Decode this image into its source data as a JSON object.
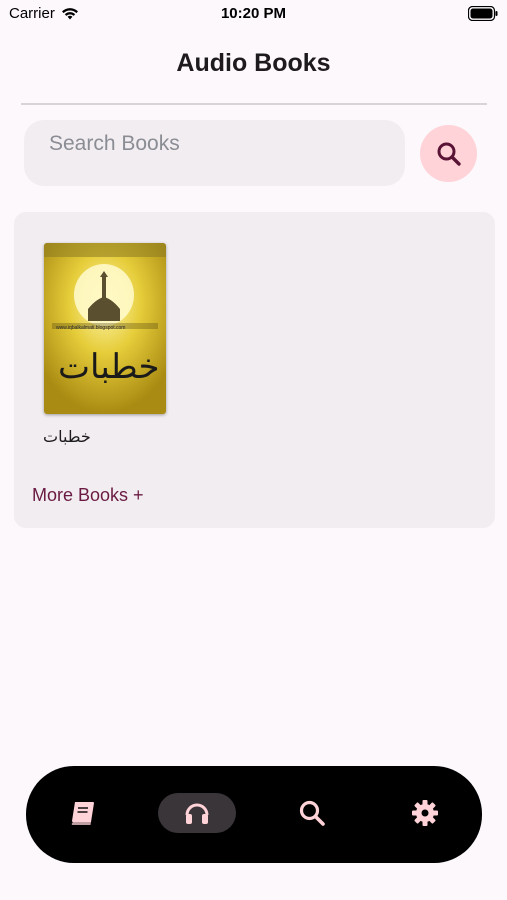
{
  "status_bar": {
    "carrier": "Carrier",
    "time": "10:20 PM"
  },
  "header": {
    "title": "Audio Books"
  },
  "search": {
    "placeholder": "Search Books",
    "value": ""
  },
  "books": [
    {
      "title": "خطبات",
      "cover_text": "خطبات",
      "cover_url_text": "www.iqbalkalmati.blogspot.com"
    }
  ],
  "more_books_label": "More Books +",
  "bottom_nav": {
    "items": [
      {
        "icon": "book-icon",
        "active": false
      },
      {
        "icon": "headphones-icon",
        "active": true
      },
      {
        "icon": "search-icon",
        "active": false
      },
      {
        "icon": "gear-icon",
        "active": false
      }
    ]
  },
  "colors": {
    "background": "#fcf8fc",
    "accent": "#6b1a42",
    "search_button": "#ffd3d8",
    "nav_icon": "#ffd3d8",
    "nav_bar": "#000000"
  }
}
